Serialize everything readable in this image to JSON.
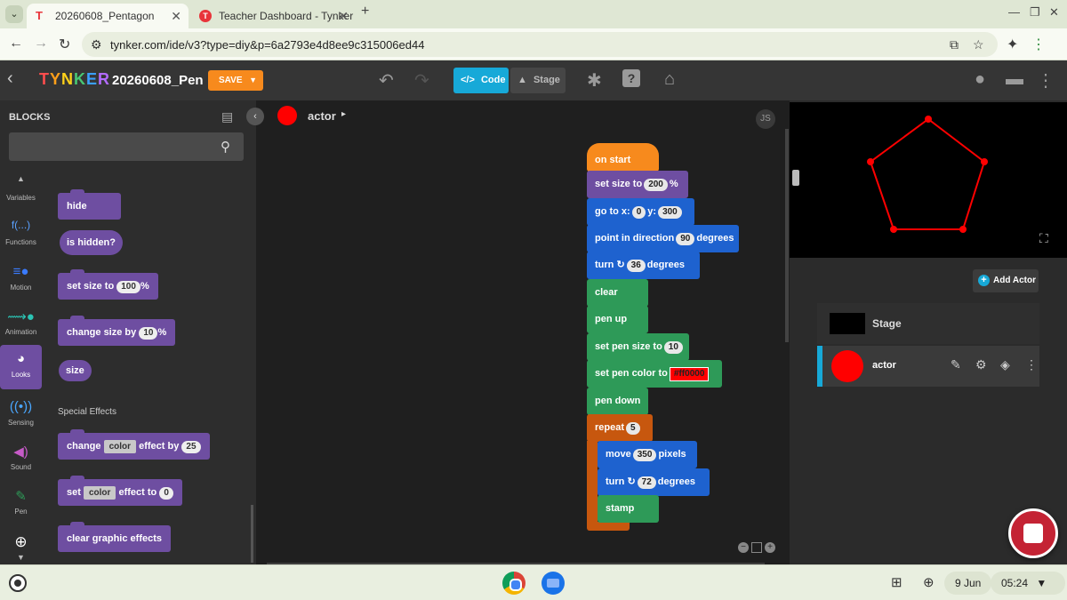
{
  "browser": {
    "tabs": [
      {
        "title": "20260608_Pentagon"
      },
      {
        "title": "Teacher Dashboard - Tynker"
      }
    ],
    "url": "tynker.com/ide/v3?type=diy&p=6a2793e4d8ee9c315006ed44"
  },
  "app": {
    "logo": "TYNKER",
    "logo_colors": [
      "#ff4d4d",
      "#ff9f1a",
      "#ffd21a",
      "#48c774",
      "#3aa0ff",
      "#b36bff"
    ],
    "project_title": "20260608_Pen",
    "save_label": "SAVE",
    "code_label": "Code",
    "stage_label": "Stage"
  },
  "blocks_panel": {
    "title": "BLOCKS",
    "search_placeholder": "",
    "categories": [
      {
        "label": "Variables",
        "icon": "variables-icon"
      },
      {
        "label": "Functions",
        "icon": "functions-icon"
      },
      {
        "label": "Motion",
        "icon": "motion-icon"
      },
      {
        "label": "Animation",
        "icon": "animation-icon"
      },
      {
        "label": "Looks",
        "icon": "looks-icon",
        "active": true
      },
      {
        "label": "Sensing",
        "icon": "sensing-icon"
      },
      {
        "label": "Sound",
        "icon": "sound-icon"
      },
      {
        "label": "Pen",
        "icon": "pen-icon"
      }
    ],
    "palette": {
      "hide": "hide",
      "is_hidden": "is hidden?",
      "set_size_to": "set size to",
      "set_size_value": "100",
      "change_size_by": "change size by",
      "change_size_value": "10",
      "percent": "%",
      "size": "size",
      "special_effects": "Special Effects",
      "change": "change",
      "color": "color",
      "effect_by": "effect by",
      "effect_by_value": "25",
      "set": "set",
      "effect_to": "effect to",
      "effect_to_value": "0",
      "clear_graphic_effects": "clear graphic effects"
    }
  },
  "workspace": {
    "actor": "actor",
    "js_badge": "JS",
    "actor_color": "#ff0000",
    "script": {
      "on_start": "on start",
      "set_size_to": "set size to",
      "size_value": "200",
      "percent": "%",
      "go_to_x": "go to x:",
      "x_value": "0",
      "y_label": "y:",
      "y_value": "300",
      "point_in_direction": "point in direction",
      "direction_value": "90",
      "degrees": "degrees",
      "turn": "turn",
      "turn_value_1": "36",
      "clear": "clear",
      "pen_up": "pen up",
      "set_pen_size_to": "set pen size to",
      "pen_size_value": "10",
      "set_pen_color_to": "set pen color to",
      "pen_color_value": "#ff0000",
      "pen_down": "pen down",
      "repeat": "repeat",
      "repeat_value": "5",
      "move": "move",
      "move_value": "350",
      "pixels": "pixels",
      "turn_value_2": "72",
      "stamp": "stamp"
    }
  },
  "stage": {
    "add_actor": "Add Actor",
    "stage_name": "Stage",
    "actor_name": "actor",
    "pen_color": "#ff0000"
  },
  "shelf": {
    "date": "9 Jun",
    "time": "05:24"
  }
}
